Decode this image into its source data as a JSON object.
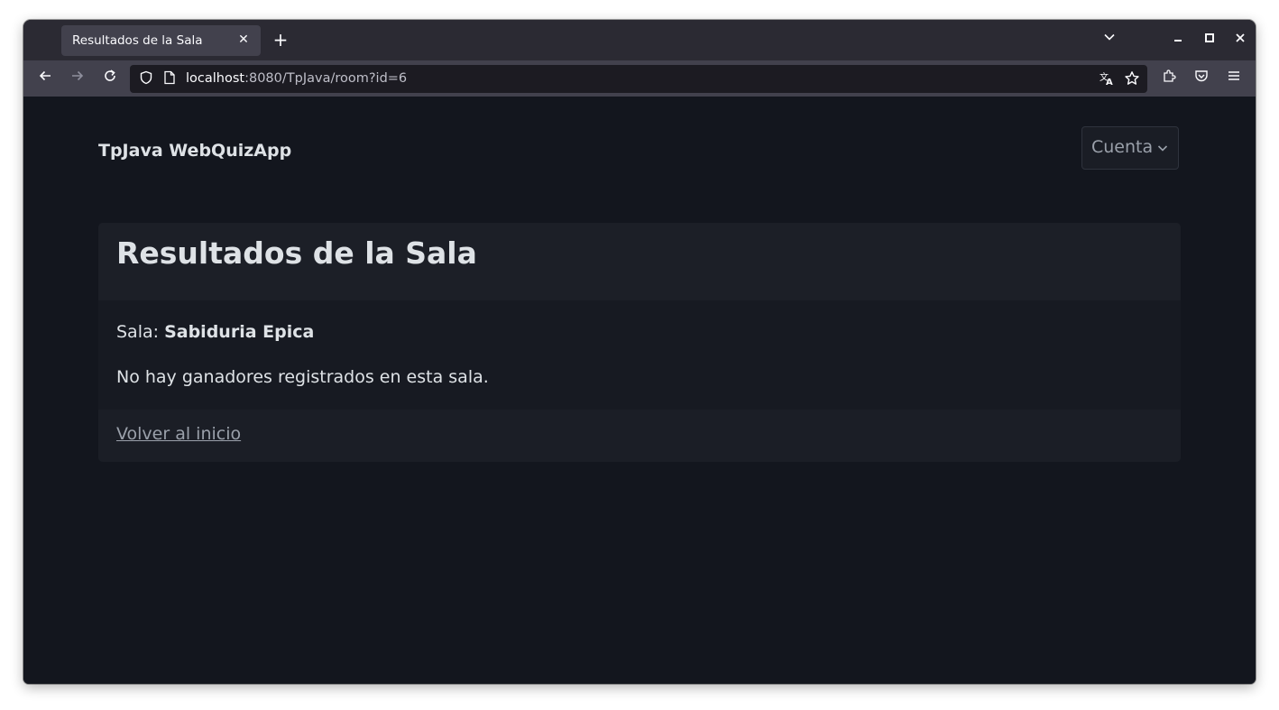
{
  "browser": {
    "tab": {
      "title": "Resultados de la Sala",
      "close": "✕"
    },
    "new_tab": "+",
    "window_controls": {
      "list_tabs": "⌄",
      "minimize": "–",
      "maximize": "◻",
      "close": "✕"
    },
    "url": {
      "host": "localhost",
      "rest": ":8080/TpJava/room?id=6"
    },
    "icons": [
      "back-icon",
      "forward-icon",
      "reload-icon",
      "shield-icon",
      "page-icon",
      "translate-icon",
      "bookmark-star-icon",
      "extensions-icon",
      "pocket-icon",
      "menu-icon"
    ]
  },
  "page": {
    "brand": "TpJava WebQuizApp",
    "account_menu": {
      "label": "Cuenta"
    },
    "card": {
      "title": "Resultados de la Sala",
      "room_prefix": "Sala: ",
      "room_name": "Sabiduria Epica",
      "empty_message": "No hay ganadores registrados en esta sala.",
      "back_link": "Volver al inicio"
    }
  }
}
